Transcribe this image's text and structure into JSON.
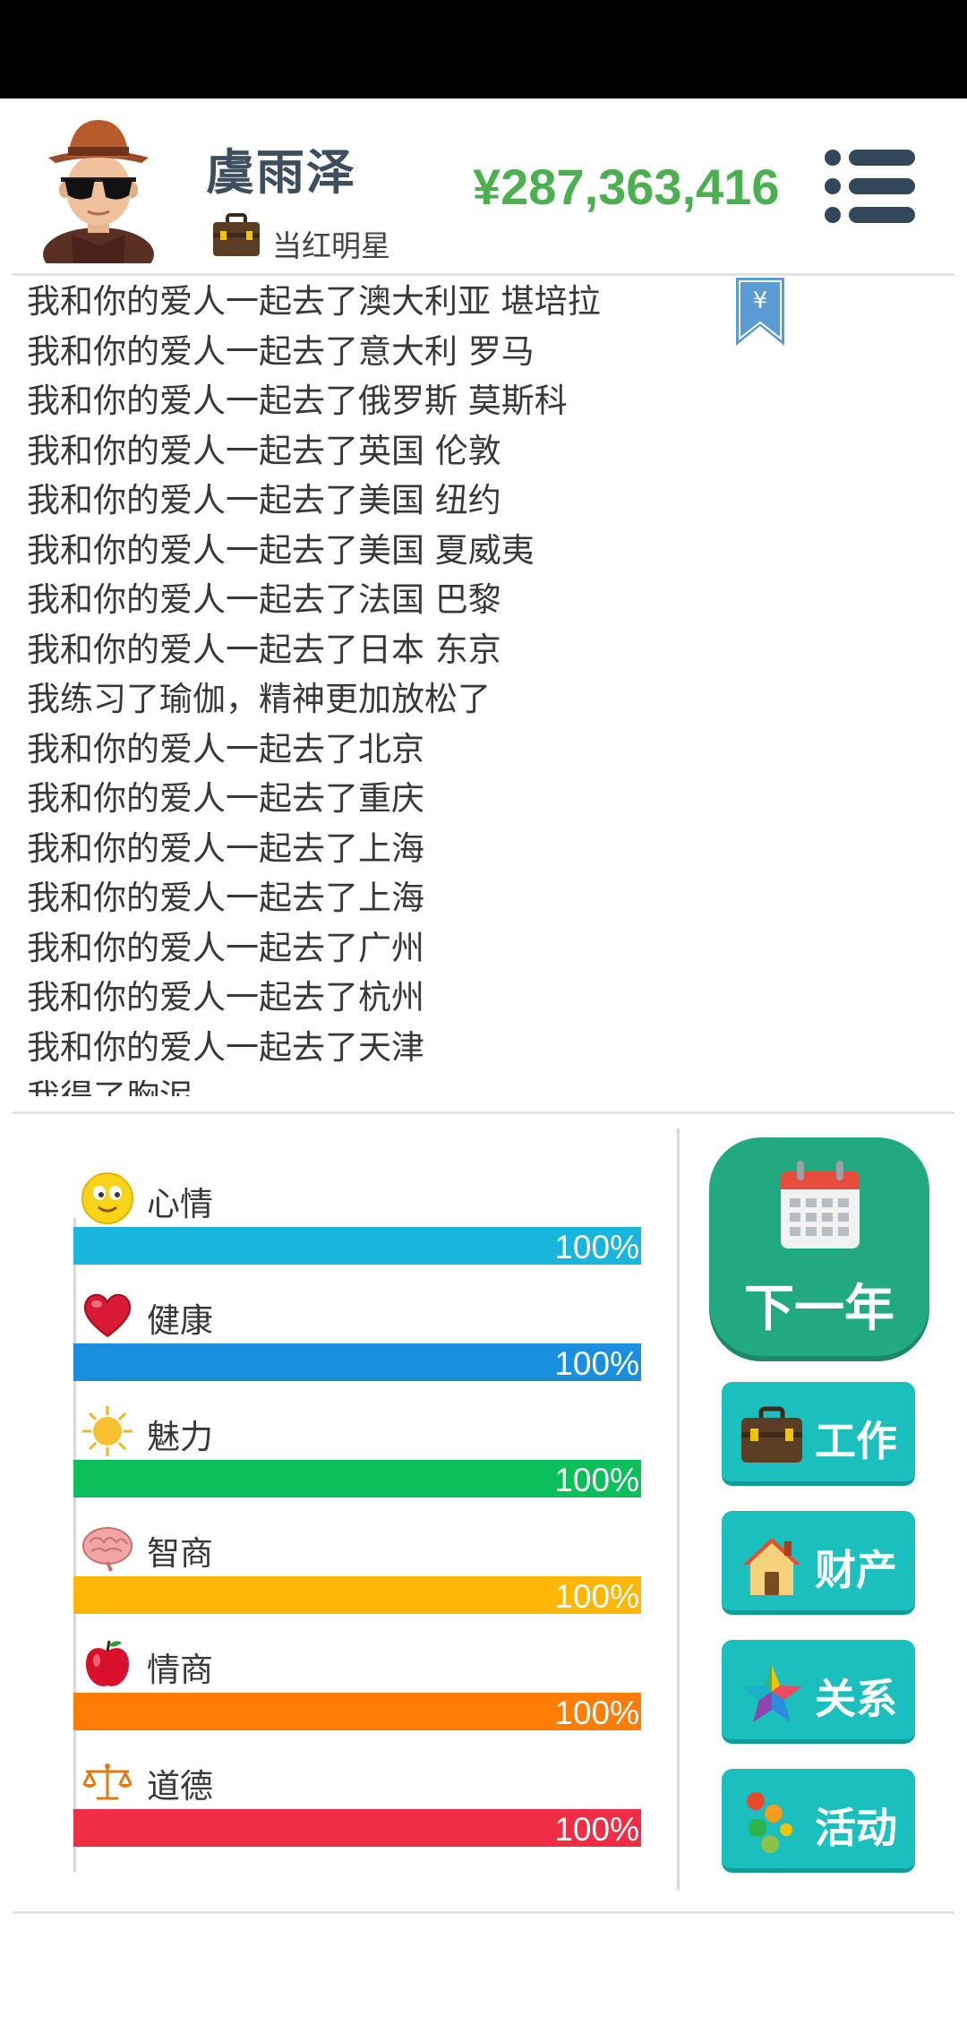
{
  "header": {
    "player_name": "虞雨泽",
    "job_title": "当红明星",
    "money": "¥287,363,416"
  },
  "log": {
    "bookmark_symbol": "¥",
    "entries": [
      "我和你的爱人一起去了澳大利亚 堪培拉",
      "我和你的爱人一起去了意大利 罗马",
      "我和你的爱人一起去了俄罗斯 莫斯科",
      "我和你的爱人一起去了英国 伦敦",
      "我和你的爱人一起去了美国 纽约",
      "我和你的爱人一起去了美国 夏威夷",
      "我和你的爱人一起去了法国 巴黎",
      "我和你的爱人一起去了日本 东京",
      "我练习了瑜伽，精神更加放松了",
      "我和你的爱人一起去了北京",
      "我和你的爱人一起去了重庆",
      "我和你的爱人一起去了上海",
      "我和你的爱人一起去了上海",
      "我和你的爱人一起去了广州",
      "我和你的爱人一起去了杭州",
      "我和你的爱人一起去了天津",
      "我得了胸泥"
    ]
  },
  "stats": [
    {
      "label": "心情",
      "value": 1.0,
      "pct": "100%",
      "color": "#1ab5dc",
      "icon": "smiley-icon"
    },
    {
      "label": "健康",
      "value": 1.0,
      "pct": "100%",
      "color": "#1a8fe0",
      "icon": "heart-icon"
    },
    {
      "label": "魅力",
      "value": 1.0,
      "pct": "100%",
      "color": "#0bbf5a",
      "icon": "sun-icon"
    },
    {
      "label": "智商",
      "value": 1.0,
      "pct": "100%",
      "color": "#ffb607",
      "icon": "brain-icon"
    },
    {
      "label": "情商",
      "value": 1.0,
      "pct": "100%",
      "color": "#ff7d07",
      "icon": "apple-icon"
    },
    {
      "label": "道德",
      "value": 1.0,
      "pct": "100%",
      "color": "#ef2d45",
      "icon": "scales-icon"
    }
  ],
  "actions": {
    "next_year": "下一年",
    "work": "工作",
    "property": "财产",
    "relations": "关系",
    "activities": "活动"
  },
  "colors": {
    "money": "#4caf50",
    "next_year_button": "#22a97f",
    "action_button": "#1bbfbd"
  }
}
